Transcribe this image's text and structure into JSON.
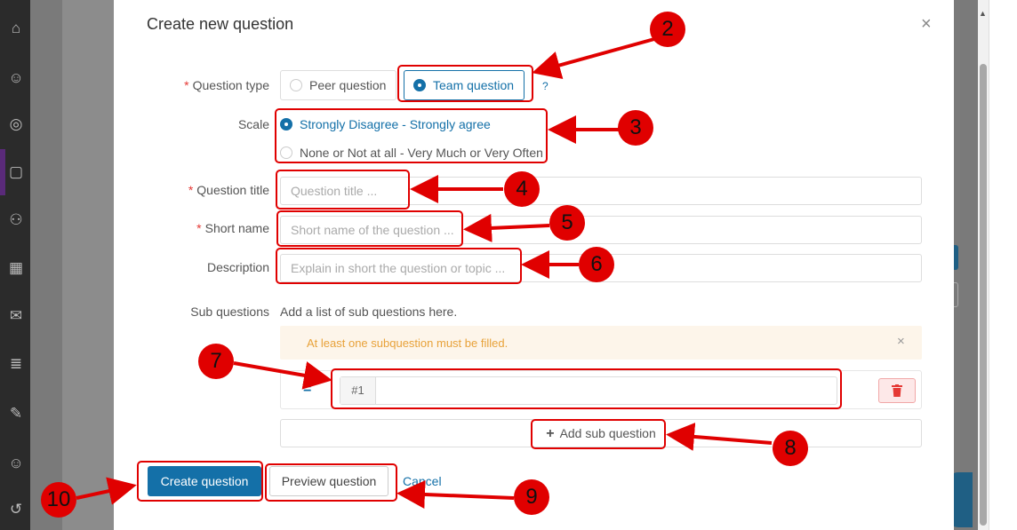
{
  "modal": {
    "title": "Create new question",
    "close_icon": "×"
  },
  "form": {
    "question_type": {
      "label": "Question type",
      "required_mark": "*",
      "options": [
        "Peer question",
        "Team question"
      ],
      "selected": "Team question",
      "help": "?"
    },
    "scale": {
      "label": "Scale",
      "options": [
        "Strongly Disagree - Strongly agree",
        "None or Not at all - Very Much or Very Often"
      ],
      "selected": "Strongly Disagree - Strongly agree"
    },
    "question_title": {
      "label": "Question title",
      "required_mark": "*",
      "placeholder": "Question title ...",
      "value": ""
    },
    "short_name": {
      "label": "Short name",
      "required_mark": "*",
      "placeholder": "Short name of the question ...",
      "value": ""
    },
    "description": {
      "label": "Description",
      "placeholder": "Explain in short the question or topic ...",
      "value": ""
    },
    "sub_questions": {
      "label": "Sub questions",
      "hint": "Add a list of sub questions here.",
      "alert": "At least one subquestion must be filled.",
      "alert_close": "×",
      "items": [
        {
          "prefix": "#1",
          "value": ""
        }
      ],
      "drag_handle": "=",
      "add_label": "Add sub question",
      "add_icon": "+"
    }
  },
  "footer": {
    "create_label": "Create question",
    "preview_label": "Preview question",
    "cancel_label": "Cancel"
  },
  "annotations": [
    "2",
    "3",
    "4",
    "5",
    "6",
    "7",
    "8",
    "9",
    "10"
  ],
  "colors": {
    "primary": "#1470a8",
    "annotation_red": "#e00000",
    "alert_bg": "#fdf5ea",
    "alert_text": "#e8a23a",
    "danger_bg": "#fde8e8"
  }
}
